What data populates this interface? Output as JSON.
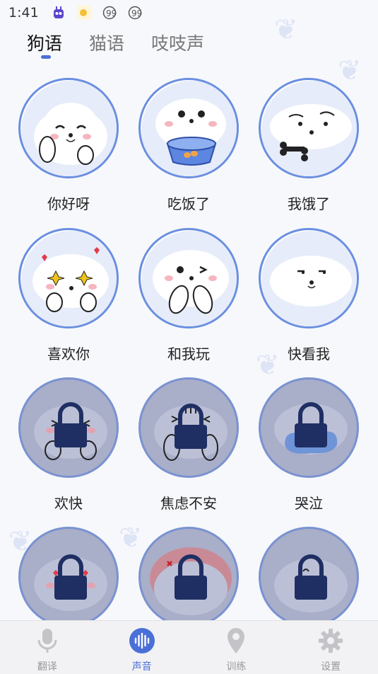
{
  "status_bar": {
    "time": "1:41"
  },
  "tabs": [
    {
      "label": "狗语"
    },
    {
      "label": "猫语"
    },
    {
      "label": "吱吱声"
    }
  ],
  "sounds": [
    {
      "label": "你好呀",
      "locked": false
    },
    {
      "label": "吃饭了",
      "locked": false
    },
    {
      "label": "我饿了",
      "locked": false
    },
    {
      "label": "喜欢你",
      "locked": false
    },
    {
      "label": "和我玩",
      "locked": false
    },
    {
      "label": "快看我",
      "locked": false
    },
    {
      "label": "欢快",
      "locked": true
    },
    {
      "label": "焦虑不安",
      "locked": true
    },
    {
      "label": "哭泣",
      "locked": true
    },
    {
      "label": "",
      "locked": true
    },
    {
      "label": "",
      "locked": true
    },
    {
      "label": "",
      "locked": true
    }
  ],
  "nav": [
    {
      "label": "翻译",
      "icon": "microphone-icon"
    },
    {
      "label": "声音",
      "icon": "sound-wave-icon"
    },
    {
      "label": "训练",
      "icon": "location-pin-icon"
    },
    {
      "label": "设置",
      "icon": "gear-icon"
    }
  ],
  "colors": {
    "accent": "#4a6fd8",
    "ring": "#6a8fe0",
    "locked_fill": "#a9aec9",
    "lock": "#1f2f63"
  }
}
